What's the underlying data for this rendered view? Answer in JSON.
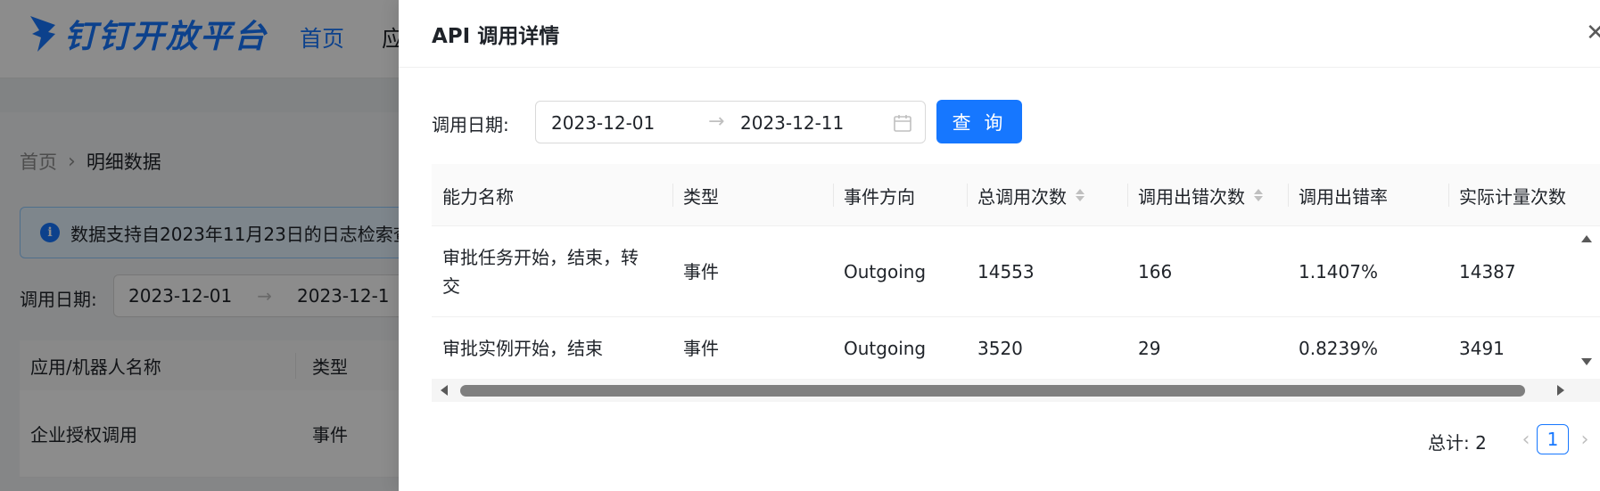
{
  "background": {
    "logo_text": "钉钉开放平台",
    "nav": [
      "首页",
      "应"
    ],
    "breadcrumb": {
      "home": "首页",
      "current": "明细数据"
    },
    "alert_text": "数据支持自2023年11月23日的日志检索查",
    "date_label": "调用日期:",
    "date_start": "2023-12-01",
    "date_end": "2023-12-1",
    "table_headers": [
      "应用/机器人名称",
      "类型"
    ],
    "table_row": [
      "企业授权调用",
      "事件"
    ]
  },
  "drawer": {
    "title": "API 调用详情",
    "close_symbol": "✕",
    "filter": {
      "label": "调用日期:",
      "start_date": "2023-12-01",
      "arrow": "→",
      "end_date": "2023-12-11",
      "query_label": "查 询"
    },
    "table": {
      "columns": [
        "能力名称",
        "类型",
        "事件方向",
        "总调用次数",
        "调用出错次数",
        "调用出错率",
        "实际计量次数"
      ],
      "rows": [
        [
          "审批任务开始，结束，转交",
          "事件",
          "Outgoing",
          "14553",
          "166",
          "1.1407%",
          "14387"
        ],
        [
          "审批实例开始，结束",
          "事件",
          "Outgoing",
          "3520",
          "29",
          "0.8239%",
          "3491"
        ]
      ]
    },
    "pagination": {
      "total_text": "总计:  2",
      "prev": "‹",
      "current_page": "1",
      "next": "›"
    }
  },
  "colors": {
    "primary": "#1677ff",
    "mask": "rgba(0,0,0,0.45)"
  }
}
